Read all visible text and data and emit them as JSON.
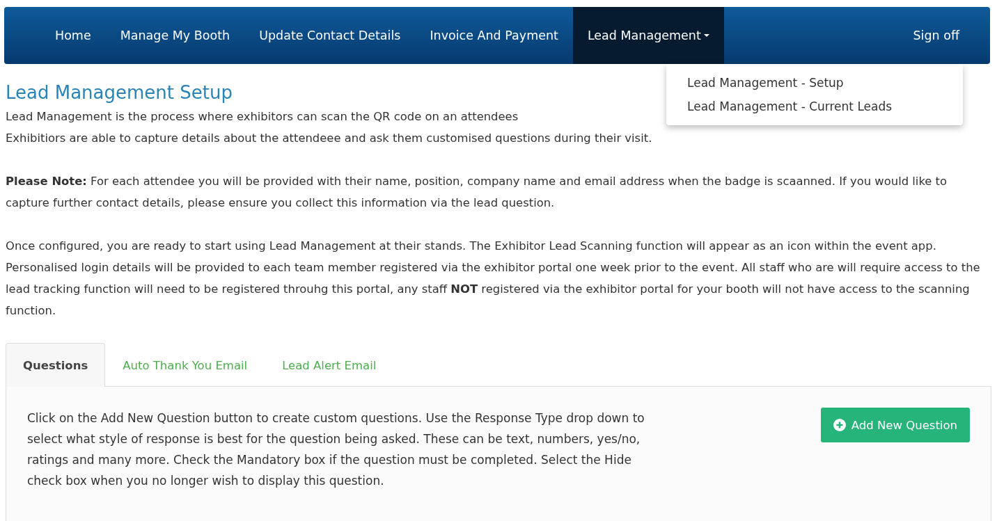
{
  "nav": {
    "items": [
      {
        "label": "Home",
        "selected": false,
        "dropdown": false
      },
      {
        "label": "Manage My Booth",
        "selected": false,
        "dropdown": false
      },
      {
        "label": "Update Contact Details",
        "selected": false,
        "dropdown": false
      },
      {
        "label": "Invoice And Payment",
        "selected": false,
        "dropdown": false
      },
      {
        "label": "Lead Management",
        "selected": true,
        "dropdown": true
      }
    ],
    "sign_off": "Sign off",
    "menu": {
      "expanded": true,
      "items": [
        "Lead Management - Setup",
        "Lead Management - Current Leads"
      ]
    }
  },
  "page": {
    "title": "Lead Management Setup",
    "paragraphs": [
      [
        "Lead Management is the process where exhibitors can scan the QR code on an attendees",
        "Exhibitiors are able to capture details about the attendeee and ask them customised questions during their visit."
      ],
      "**Please Note:** For each attendee you will be provided with their name, position, company name and email address when the badge is scaanned. If you would like to capture further contact details, please ensure you collect this information via the lead question.",
      "Once configured, you are ready to start using Lead Management at their stands. The Exhibitor Lead Scanning function will appear as an icon within the event app. Personalised login details will be provided to each team member registered via the exhibitor portal one week prior to the event. All staff who are will require access to the lead tracking function will need to be registered throuhg this portal, any staff **NOT** registered via the exhibitor portal for your booth will not have access to the scanning function."
    ]
  },
  "tabs": [
    {
      "label": "Questions",
      "selected": true
    },
    {
      "label": "Auto Thank You Email",
      "selected": false
    },
    {
      "label": "Lead Alert Email",
      "selected": false
    }
  ],
  "panel": {
    "text": "Click on the Add New Question button to create custom questions. Use the Response Type drop down to select what style of response is best for the question being asked. These can be text, numbers, yes/no, ratings and many more. Check the Mandatory box if the question must be completed. Select the Hide check box when you no longer wish to display this question.",
    "button": "Add New Question"
  }
}
